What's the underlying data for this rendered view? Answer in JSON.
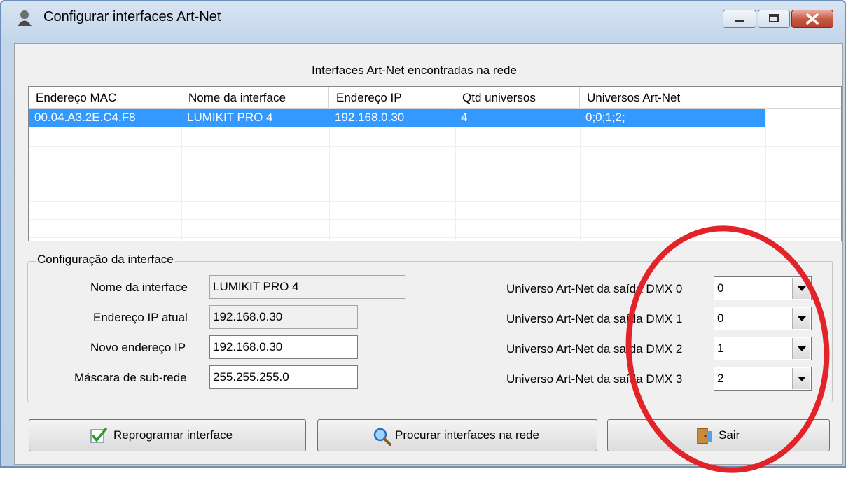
{
  "window": {
    "title": "Configurar interfaces Art-Net"
  },
  "list": {
    "caption": "Interfaces Art-Net encontradas na rede",
    "columns": [
      "Endereço MAC",
      "Nome da interface",
      "Endereço IP",
      "Qtd universos",
      "Universos Art-Net"
    ],
    "rows": [
      [
        "00.04.A3.2E.C4.F8",
        "LUMIKIT PRO 4",
        "192.168.0.30",
        "4",
        "0;0;1;2;"
      ]
    ]
  },
  "config": {
    "group_title": "Configuração da interface",
    "name_label": "Nome da interface",
    "name_value": "LUMIKIT PRO 4",
    "ip_label": "Endereço IP atual",
    "ip_value": "192.168.0.30",
    "newip_label": "Novo endereço IP",
    "newip_value": "192.168.0.30",
    "mask_label": "Máscara de sub-rede",
    "mask_value": "255.255.255.0",
    "dmx": [
      {
        "label": "Universo Art-Net da saída DMX 0",
        "value": "0"
      },
      {
        "label": "Universo Art-Net da saída DMX 1",
        "value": "0"
      },
      {
        "label": "Universo Art-Net da saída DMX 2",
        "value": "1"
      },
      {
        "label": "Universo Art-Net da saída DMX 3",
        "value": "2"
      }
    ]
  },
  "buttons": {
    "reprogram": "Reprogramar interface",
    "search": "Procurar interfaces na rede",
    "exit": "Sair"
  },
  "icons": {
    "app": "app-user-icon",
    "reprogram": "checkmark-icon",
    "search": "magnifier-icon",
    "exit": "door-exit-icon"
  },
  "colors": {
    "selection": "#3399ff",
    "annotation": "#e2232a"
  }
}
